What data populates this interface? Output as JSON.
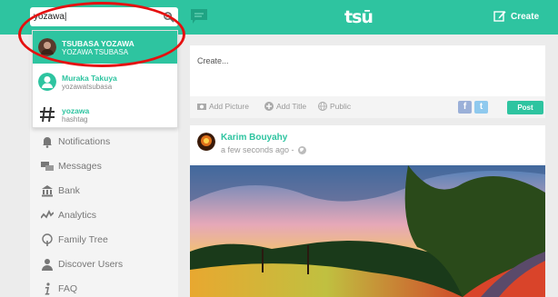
{
  "search": {
    "value": "yozawa|"
  },
  "header": {
    "logo": "tsū",
    "create_label": "Create"
  },
  "dropdown": {
    "results": [
      {
        "name": "TSUBASA YOZAWA",
        "sub": "YOZAWA  TSUBASA",
        "active": true
      },
      {
        "name": "Muraka Takuya",
        "sub": "yozawatsubasa",
        "active": false
      },
      {
        "name": "yozawa",
        "sub": "hashtag",
        "active": false
      }
    ]
  },
  "sidebar": {
    "items": [
      {
        "label": "Notifications",
        "icon": "bell-icon"
      },
      {
        "label": "Messages",
        "icon": "messages-icon"
      },
      {
        "label": "Bank",
        "icon": "bank-icon"
      },
      {
        "label": "Analytics",
        "icon": "analytics-icon"
      },
      {
        "label": "Family Tree",
        "icon": "family-tree-icon"
      },
      {
        "label": "Discover Users",
        "icon": "discover-users-icon"
      },
      {
        "label": "FAQ",
        "icon": "info-icon"
      }
    ]
  },
  "composer": {
    "placeholder": "Create...",
    "add_picture": "Add Picture",
    "add_title": "Add Title",
    "privacy": "Public",
    "facebook": "f",
    "twitter": "t",
    "post": "Post"
  },
  "post": {
    "author": "Karim Bouyahy",
    "time": "a few seconds ago -"
  },
  "colors": {
    "accent": "#2ec4a0",
    "highlight_ring": "#e51010"
  }
}
